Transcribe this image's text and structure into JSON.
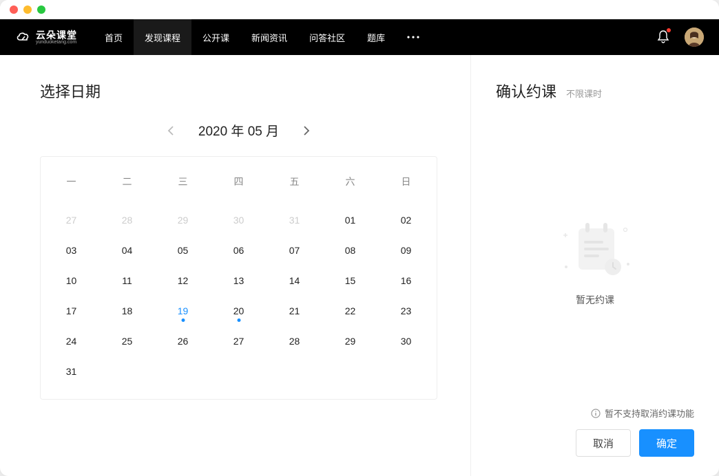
{
  "logo": {
    "cn": "云朵课堂",
    "en": "yunduoketang.com"
  },
  "nav": {
    "items": [
      "首页",
      "发现课程",
      "公开课",
      "新闻资讯",
      "问答社区",
      "题库"
    ],
    "activeIndex": 1
  },
  "calendar": {
    "title": "选择日期",
    "monthLabel": "2020 年 05 月",
    "year": 2020,
    "month": 5,
    "weekdays": [
      "一",
      "二",
      "三",
      "四",
      "五",
      "六",
      "日"
    ],
    "cells": [
      {
        "d": "27",
        "out": true
      },
      {
        "d": "28",
        "out": true
      },
      {
        "d": "29",
        "out": true
      },
      {
        "d": "30",
        "out": true
      },
      {
        "d": "31",
        "out": true
      },
      {
        "d": "01"
      },
      {
        "d": "02"
      },
      {
        "d": "03"
      },
      {
        "d": "04"
      },
      {
        "d": "05"
      },
      {
        "d": "06"
      },
      {
        "d": "07"
      },
      {
        "d": "08"
      },
      {
        "d": "09"
      },
      {
        "d": "10"
      },
      {
        "d": "11"
      },
      {
        "d": "12"
      },
      {
        "d": "13"
      },
      {
        "d": "14"
      },
      {
        "d": "15"
      },
      {
        "d": "16"
      },
      {
        "d": "17"
      },
      {
        "d": "18"
      },
      {
        "d": "19",
        "today": true,
        "dot": true
      },
      {
        "d": "20",
        "dot": true
      },
      {
        "d": "21"
      },
      {
        "d": "22"
      },
      {
        "d": "23"
      },
      {
        "d": "24"
      },
      {
        "d": "25"
      },
      {
        "d": "26"
      },
      {
        "d": "27"
      },
      {
        "d": "28"
      },
      {
        "d": "29"
      },
      {
        "d": "30"
      },
      {
        "d": "31"
      }
    ]
  },
  "booking": {
    "title": "确认约课",
    "subtitle": "不限课时",
    "emptyText": "暂无约课",
    "note": "暂不支持取消约课功能",
    "cancel": "取消",
    "confirm": "确定"
  },
  "colors": {
    "primary": "#1890ff"
  }
}
